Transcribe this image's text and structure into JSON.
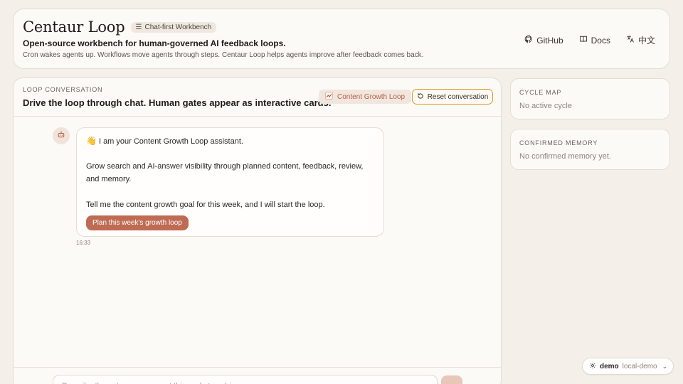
{
  "header": {
    "brand": "Centaur Loop",
    "badge": "Chat-first Workbench",
    "tagline": "Open-source workbench for human-governed AI feedback loops.",
    "subline": "Cron wakes agents up. Workflows move agents through steps. Centaur Loop helps agents improve after feedback comes back.",
    "nav": {
      "github": "GitHub",
      "docs": "Docs",
      "language": "中文"
    }
  },
  "conversation": {
    "eyebrow": "LOOP CONVERSATION",
    "title": "Drive the loop through chat. Human gates appear as interactive cards.",
    "loop_chip": "Content Growth Loop",
    "reset_label": "Reset conversation",
    "message": {
      "wave": "👋",
      "greeting": "I am your Content Growth Loop assistant.",
      "body": "Grow search and AI-answer visibility through planned content, feedback, review, and memory.",
      "prompt": "Tell me the content growth goal for this week, and I will start the loop.",
      "cta": "Plan this week's growth loop",
      "time": "16:33"
    },
    "composer_placeholder": "Describe the outcome you want this cycle to achieve..."
  },
  "sidebar": {
    "cycle_map": {
      "eyebrow": "CYCLE MAP",
      "empty": "No active cycle"
    },
    "memory": {
      "eyebrow": "CONFIRMED MEMORY",
      "empty": "No confirmed memory yet."
    }
  },
  "env": {
    "name": "demo",
    "target": "local-demo"
  },
  "colors": {
    "accent": "#bf6b53",
    "focus_ring": "#d99a2b",
    "background": "#f4efe8"
  }
}
